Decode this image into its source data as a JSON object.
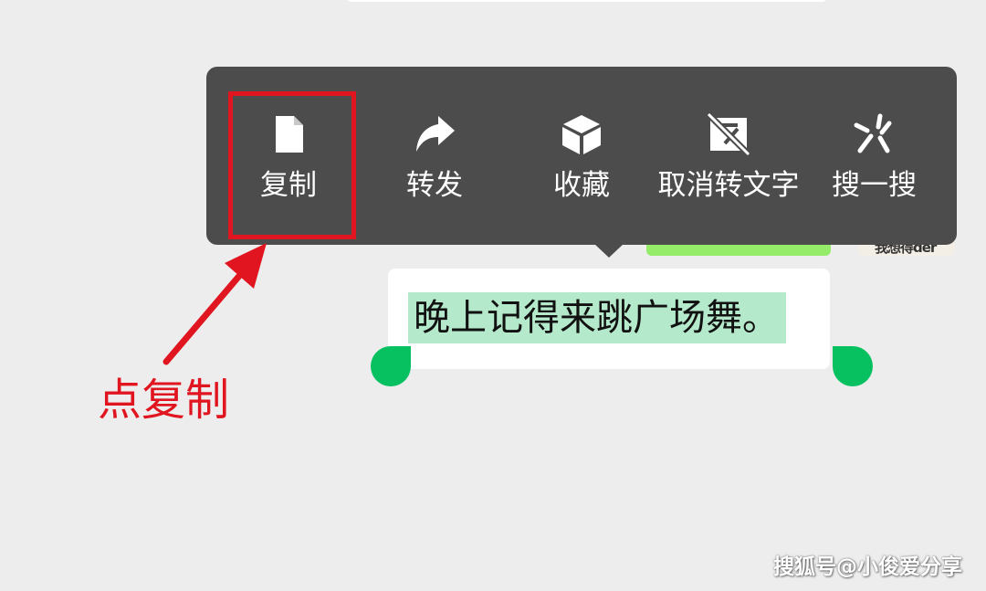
{
  "background_color": "#ededed",
  "background": {
    "avatar_text": "我想得der"
  },
  "context_menu": {
    "background_color": "#4c4c4c",
    "items": [
      {
        "label": "复制",
        "icon": "document-icon"
      },
      {
        "label": "转发",
        "icon": "forward-arrow-icon"
      },
      {
        "label": "收藏",
        "icon": "cube-icon"
      },
      {
        "label": "取消转文字",
        "icon": "cancel-transcribe-icon"
      },
      {
        "label": "搜一搜",
        "icon": "search-sparkle-icon"
      }
    ]
  },
  "message": {
    "text": "晚上记得来跳广场舞。",
    "selection_color": "#b5e9cb",
    "handle_color": "#07c160"
  },
  "annotation": {
    "text": "点复制",
    "color": "#e0151f",
    "target": "复制"
  },
  "watermark": {
    "text": "搜狐号@小俊爱分享"
  }
}
